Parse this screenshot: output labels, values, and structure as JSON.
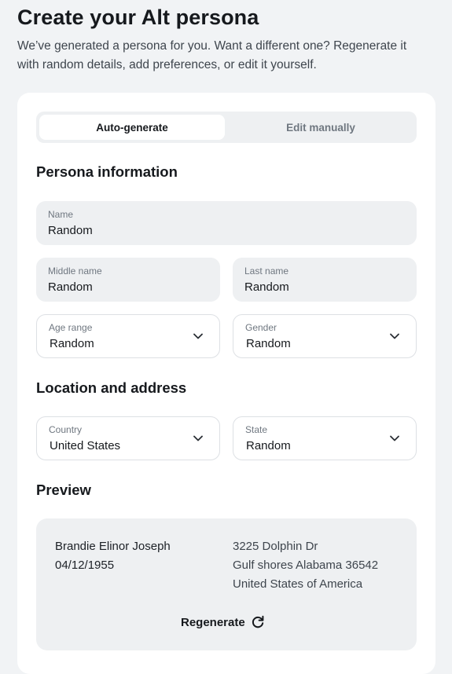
{
  "header": {
    "title": "Create your Alt persona",
    "subtitle": "We’ve generated a persona for you. Want a different one? Regenerate it with random details, add preferences, or edit it yourself."
  },
  "tabs": [
    {
      "label": "Auto-generate",
      "active": true
    },
    {
      "label": "Edit manually",
      "active": false
    }
  ],
  "persona_information": {
    "title": "Persona information",
    "name": {
      "label": "Name",
      "value": "Random"
    },
    "middle_name": {
      "label": "Middle name",
      "value": "Random"
    },
    "last_name": {
      "label": "Last name",
      "value": "Random"
    },
    "age_range": {
      "label": "Age range",
      "value": "Random"
    },
    "gender": {
      "label": "Gender",
      "value": "Random"
    }
  },
  "location": {
    "title": "Location and address",
    "country": {
      "label": "Country",
      "value": "United States"
    },
    "state": {
      "label": "State",
      "value": "Random"
    }
  },
  "preview": {
    "title": "Preview",
    "full_name": "Brandie Elinor Joseph",
    "dob": "04/12/1955",
    "address_line1": "3225 Dolphin Dr",
    "address_line2": "Gulf shores Alabama 36542",
    "address_line3": "United States of America",
    "regenerate_label": "Regenerate"
  },
  "icons": {
    "dropdown": "chevron-down-icon",
    "regenerate": "refresh-icon"
  },
  "colors": {
    "background": "#f1f3f5",
    "card": "#ffffff",
    "field_fill": "#eef0f2",
    "text_primary": "#16191d",
    "text_muted": "#6f7780"
  }
}
